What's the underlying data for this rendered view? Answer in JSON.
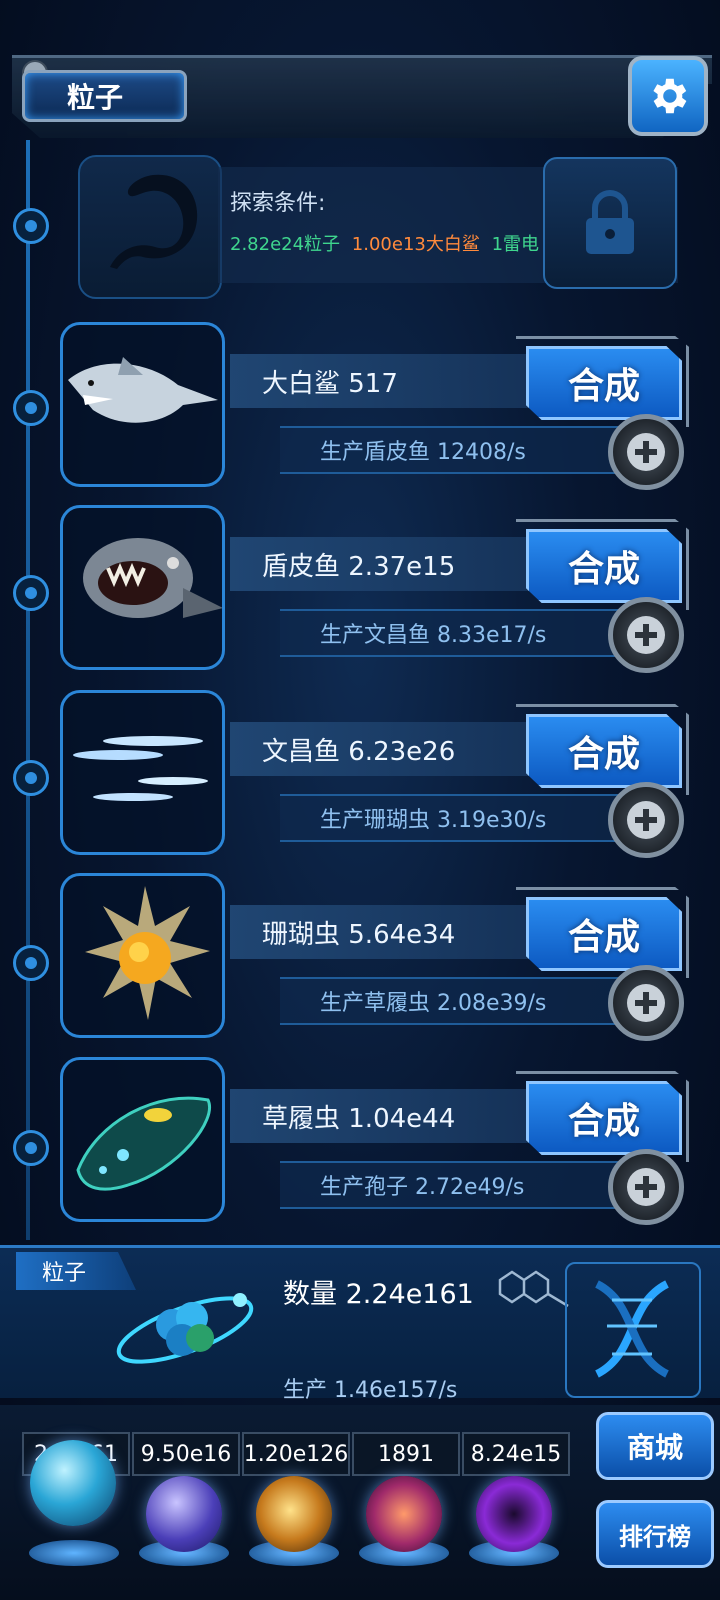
{
  "header": {
    "title": "粒子"
  },
  "locked": {
    "title": "探索条件:",
    "conditions": [
      {
        "text": "2.82e24粒子",
        "color": "#3fd68e"
      },
      {
        "text": "1.00e13大白鲨",
        "color": "#ff8a3c"
      },
      {
        "text": "1雷电",
        "color": "#3fd68e"
      }
    ]
  },
  "creatures": [
    {
      "name": "大白鲨 517",
      "merge": "合成",
      "production": "生产盾皮鱼 12408/s",
      "icon": "shark-icon"
    },
    {
      "name": "盾皮鱼 2.37e15",
      "merge": "合成",
      "production": "生产文昌鱼 8.33e17/s",
      "icon": "dunkleosteus-icon"
    },
    {
      "name": "文昌鱼 6.23e26",
      "merge": "合成",
      "production": "生产珊瑚虫 3.19e30/s",
      "icon": "lancelet-icon"
    },
    {
      "name": "珊瑚虫 5.64e34",
      "merge": "合成",
      "production": "生产草履虫 2.08e39/s",
      "icon": "coral-polyp-icon"
    },
    {
      "name": "草履虫 1.04e44",
      "merge": "合成",
      "production": "生产孢子 2.72e49/s",
      "icon": "paramecium-icon"
    }
  ],
  "particle_panel": {
    "tag": "粒子",
    "count": "数量 2.24e161",
    "production": "生产 1.46e157/s"
  },
  "currencies": [
    "2.2...61",
    "9.50e16",
    "1.20e126",
    "1891",
    "8.24e15"
  ],
  "side_buttons": {
    "shop": "商城",
    "ranking": "排行榜"
  },
  "colors": {
    "accent": "#2a8cf0",
    "panel": "#0c2c55",
    "green": "#3fd68e",
    "orange": "#ff8a3c"
  }
}
